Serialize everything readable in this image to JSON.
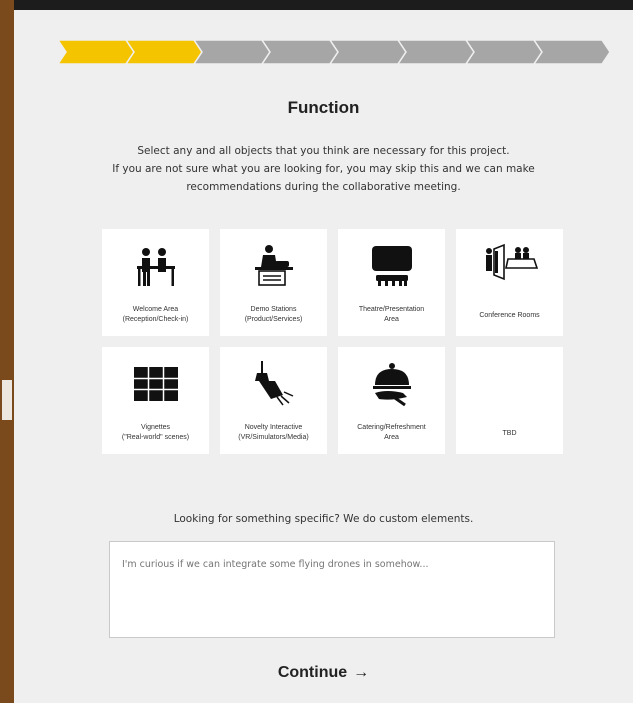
{
  "progress": {
    "total_steps": 8,
    "completed_steps": 2,
    "active_color": "#f5c400",
    "inactive_color": "#a6a6a6"
  },
  "page": {
    "title": "Function",
    "intro_lines": [
      "Select any and all objects that you think are necessary for this project.",
      "If you are not sure what you are looking for, you may skip this and we can make",
      "recommendations during the collaborative meeting."
    ]
  },
  "options": [
    {
      "icon": "reception-desk-icon",
      "label_lines": [
        "Welcome Area",
        "(Reception/Check-in)"
      ]
    },
    {
      "icon": "demo-station-icon",
      "label_lines": [
        "Demo Stations",
        "(Product/Services)"
      ]
    },
    {
      "icon": "theatre-icon",
      "label_lines": [
        "Theatre/Presentation",
        "Area"
      ]
    },
    {
      "icon": "conference-room-icon",
      "label_lines": [
        "Conference Rooms"
      ]
    },
    {
      "icon": "grid-icon",
      "label_lines": [
        "Vignettes",
        "(\"Real-world\" scenes)"
      ]
    },
    {
      "icon": "vr-headset-icon",
      "label_lines": [
        "Novelty Interactive",
        "(VR/Simulators/Media)"
      ]
    },
    {
      "icon": "cloche-icon",
      "label_lines": [
        "Catering/Refreshment",
        "Area"
      ]
    },
    {
      "icon": "",
      "label_lines": [
        "TBD"
      ]
    }
  ],
  "custom": {
    "prompt": "Looking for something specific? We do custom elements.",
    "placeholder": "I'm curious if we can integrate some flying drones in somehow..."
  },
  "continue": {
    "label": "Continue",
    "arrow": "→"
  }
}
